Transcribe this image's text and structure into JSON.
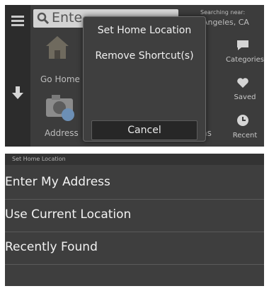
{
  "nav_screen": {
    "search_text": "Ente",
    "searching_near_label": "Searching near:",
    "searching_near_city": "os Angeles, CA",
    "shortcuts": [
      {
        "label": "Go Home",
        "icon": "house-icon"
      },
      {
        "label": "Address",
        "icon": "camera-icon"
      }
    ],
    "right_partial_text": "ns",
    "side_buttons": [
      {
        "label": "Categories",
        "icon": "categories-icon"
      },
      {
        "label": "Saved",
        "icon": "heart-icon"
      },
      {
        "label": "Recent",
        "icon": "clock-icon"
      }
    ]
  },
  "popup": {
    "items": [
      "Set Home Location",
      "Remove Shortcut(s)"
    ],
    "cancel_label": "Cancel"
  },
  "home_screen": {
    "header": "Set Home Location",
    "options": [
      "Enter My Address",
      "Use Current Location",
      "Recently Found"
    ]
  },
  "colors": {
    "screen_bg": "#3c3c3c",
    "popup_bg": "#3f3f3f",
    "text": "#f0f0f0"
  }
}
